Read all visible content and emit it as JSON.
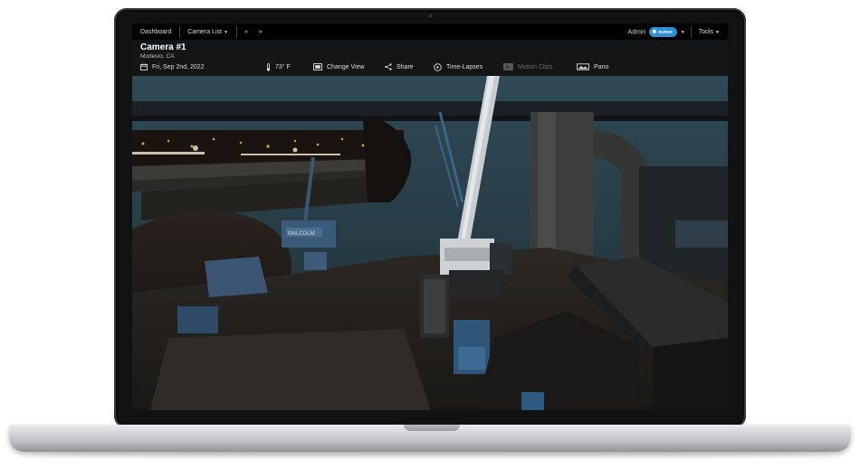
{
  "nav": {
    "dashboard": "Dashboard",
    "camera_list": "Camera List",
    "prev_glyph": "«",
    "next_glyph": "»",
    "admin": "Admin",
    "badge": "SUPER",
    "tools": "Tools"
  },
  "camera": {
    "title": "Camera #1",
    "location": "Modesto, CA"
  },
  "toolbar": {
    "date": "Fri, Sep 2nd, 2022",
    "temperature": "73° F",
    "change_view": "Change View",
    "share": "Share",
    "time_lapses": "Time-Lapses",
    "motion_clips": "Motion Clips",
    "pano": "Pano"
  },
  "feed": {
    "crane_label": "MALCOLM"
  },
  "colors": {
    "accent": "#2e8fd6",
    "nav_bg": "#000000",
    "header_bg": "#141517"
  },
  "icons": [
    "calendar-icon",
    "thermometer-icon",
    "change-view-icon",
    "share-icon",
    "play-circle-icon",
    "motion-clips-icon",
    "pano-icon"
  ]
}
